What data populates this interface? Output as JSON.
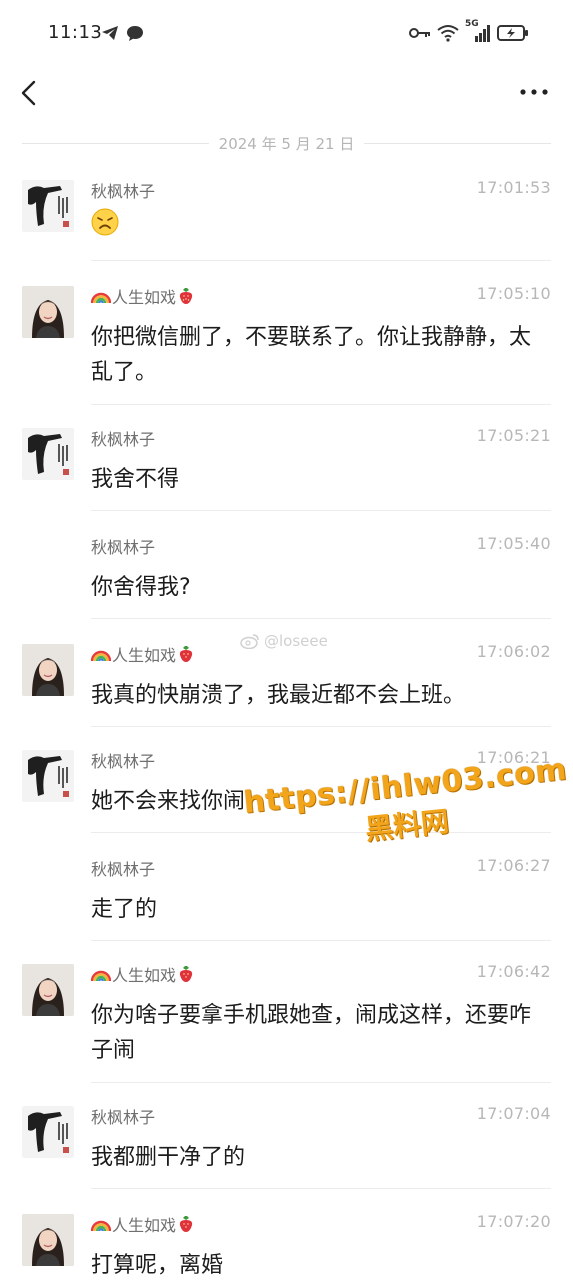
{
  "status": {
    "time": "11:13",
    "network": "5G",
    "left_icons": [
      "telegram-icon",
      "chat-bubble-icon"
    ],
    "right_icons": [
      "key-icon",
      "wifi-icon",
      "signal-icon",
      "battery-charging-icon"
    ]
  },
  "nav": {
    "back_icon": "chevron-left-icon",
    "more_icon": "more-dots-icon"
  },
  "date_label": "2024 年 5 月 21 日",
  "watermark": {
    "small": "@loseee",
    "url": "https://ihlw03.com",
    "cn": "黑料网",
    "color": "#f2a51a"
  },
  "senders": {
    "a": "秋枫林子",
    "b": "人生如戏"
  },
  "messages": [
    {
      "sender": "秋枫林子",
      "time": "17:01:53",
      "text": "",
      "emoji": "sad-face"
    },
    {
      "sender": "人生如戏",
      "time": "17:05:10",
      "text": "你把微信删了，不要联系了。你让我静静，太乱了。"
    },
    {
      "sender": "秋枫林子",
      "time": "17:05:21",
      "text": "我舍不得"
    },
    {
      "sender": "秋枫林子",
      "time": "17:05:40",
      "text": "你舍得我?"
    },
    {
      "sender": "人生如戏",
      "time": "17:06:02",
      "text": "我真的快崩溃了，我最近都不会上班。"
    },
    {
      "sender": "秋枫林子",
      "time": "17:06:21",
      "text": "她不会来找你闹"
    },
    {
      "sender": "秋枫林子",
      "time": "17:06:27",
      "text": "走了的"
    },
    {
      "sender": "人生如戏",
      "time": "17:06:42",
      "text": "你为啥子要拿手机跟她查，闹成这样，还要咋子闹"
    },
    {
      "sender": "秋枫林子",
      "time": "17:07:04",
      "text": "我都删干净了的"
    },
    {
      "sender": "人生如戏",
      "time": "17:07:20",
      "text": "打算呢，离婚"
    }
  ]
}
